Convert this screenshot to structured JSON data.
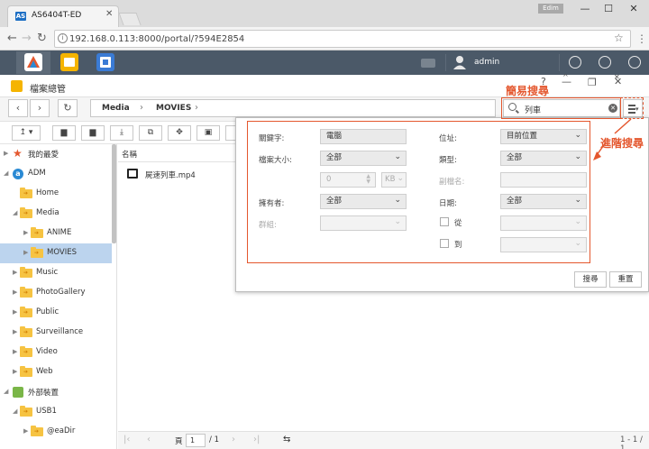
{
  "browser": {
    "tab_title": "AS6404T-ED",
    "tab_icon_text": "AS",
    "url": "192.168.0.113:8000/portal/?594E2854",
    "user_chip": "Edim"
  },
  "adm": {
    "user": "admin"
  },
  "file_explorer": {
    "title": "檔案總管",
    "breadcrumb": [
      "Media",
      "MOVIES"
    ]
  },
  "search": {
    "value": "列車",
    "simple_label": "簡易搜尋",
    "advanced_label": "進階搜尋"
  },
  "sidebar": {
    "items": [
      {
        "label": "我的最愛"
      },
      {
        "label": "ADM"
      },
      {
        "label": "Home"
      },
      {
        "label": "Media"
      },
      {
        "label": "ANIME"
      },
      {
        "label": "MOVIES"
      },
      {
        "label": "Music"
      },
      {
        "label": "PhotoGallery"
      },
      {
        "label": "Public"
      },
      {
        "label": "Surveillance"
      },
      {
        "label": "Video"
      },
      {
        "label": "Web"
      },
      {
        "label": "外部裝置"
      },
      {
        "label": "USB1"
      },
      {
        "label": "@eaDir"
      }
    ]
  },
  "filelist": {
    "column_name": "名稱",
    "files": [
      {
        "name": "屍速列車.mp4"
      }
    ]
  },
  "pagination": {
    "page_label": "頁",
    "page": "1",
    "total": "/ 1",
    "range": "1 - 1 / 1"
  },
  "advanced_search": {
    "keyword_label": "關鍵字:",
    "keyword_value": "電腦",
    "filesize_label": "檔案大小:",
    "filesize_op": "全部",
    "filesize_num": "0",
    "filesize_unit": "KB",
    "owner_label": "擁有者:",
    "owner_value": "全部",
    "group_label": "群組:",
    "location_label": "位址:",
    "location_value": "目前位置",
    "type_label": "類型:",
    "type_value": "全部",
    "ext_label": "副檔名:",
    "date_label": "日期:",
    "date_value": "全部",
    "from_label": "從",
    "to_label": "到",
    "search_button": "搜尋",
    "reset_button": "重置"
  }
}
